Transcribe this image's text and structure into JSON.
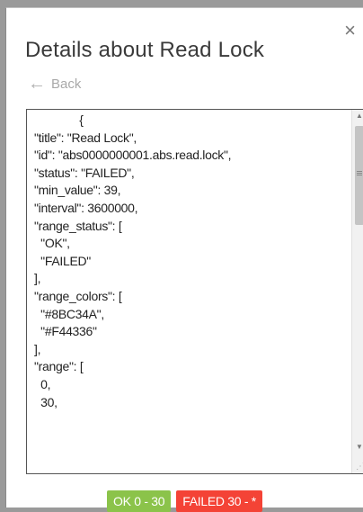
{
  "dialog": {
    "title": "Details about Read Lock",
    "close_icon": "×",
    "back_label": "Back",
    "back_icon": "←"
  },
  "json_view": {
    "text": "              {\n\"title\": \"Read Lock\",\n\"id\": \"abs0000000001.abs.read.lock\",\n\"status\": \"FAILED\",\n\"min_value\": 39,\n\"interval\": 3600000,\n\"range_status\": [\n  \"OK\",\n  \"FAILED\"\n],\n\"range_colors\": [\n  \"#8BC34A\",\n  \"#F44336\"\n],\n\"range\": [\n  0,\n  30,"
  },
  "legend": [
    {
      "label": "OK 0 - 30",
      "color": "#8BC34A"
    },
    {
      "label": "FAILED 30 - *",
      "color": "#F44336"
    }
  ]
}
